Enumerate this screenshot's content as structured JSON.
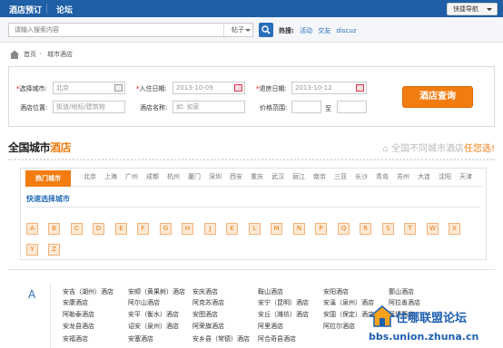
{
  "topbar": {
    "hotel_booking": "酒店预订",
    "forum": "论坛",
    "quick_nav": "快捷导航"
  },
  "search": {
    "placeholder": "请输入搜索内容",
    "scope": "帖子",
    "hot_label": "热搜:",
    "hot_tags": [
      "活动",
      "交友",
      "discuz"
    ]
  },
  "breadcrumb": {
    "home": "首页",
    "current": "城市酒店"
  },
  "form": {
    "city_label": "选择城市:",
    "city_value": "北京",
    "checkin_label": "入住日期:",
    "checkin_value": "2013-10-09",
    "checkout_label": "退房日期:",
    "checkout_value": "2013-10-12",
    "location_label": "酒店位置:",
    "location_placeholder": "街道/地标/建筑物",
    "name_label": "酒店名称:",
    "name_placeholder": "如: 如家",
    "price_label": "价格范围:",
    "price_to": "至",
    "submit": "酒店查询"
  },
  "city_section": {
    "title_prefix": "全国城市",
    "title_highlight": "酒店",
    "slogan_prefix": "全国不同城市酒店",
    "slogan_highlight": "任您选!",
    "hot_tab": "热门城市",
    "hot_cities": [
      "北京",
      "上海",
      "广州",
      "成都",
      "杭州",
      "厦门",
      "深圳",
      "西安",
      "重庆",
      "武汉",
      "丽江",
      "南京",
      "三亚",
      "长沙",
      "青岛",
      "苏州",
      "大连",
      "沈阳",
      "天津"
    ],
    "quick_pick": "快速选择城市",
    "letters": [
      "A",
      "B",
      "C",
      "D",
      "E",
      "F",
      "G",
      "H",
      "J",
      "K",
      "L",
      "M",
      "N",
      "P",
      "Q",
      "R",
      "S",
      "T",
      "W",
      "X",
      "Y",
      "Z"
    ]
  },
  "a_list": {
    "letter": "A",
    "cities": [
      [
        "安吉（湖州）酒店",
        "安顺（黄果树）酒店",
        "安庆酒店",
        "鞍山酒店",
        "安阳酒店",
        "鄞山酒店"
      ],
      [
        "安康酒店",
        "阿尔山酒店",
        "阿克苏酒店",
        "安宁（昆明）酒店",
        "安溪（泉州）酒店",
        "阿拉善酒店"
      ],
      [
        "阿勒泰酒店",
        "安平（衡水）酒店",
        "安图酒店",
        "安丘（潍坊）酒店",
        "安国（保定）酒店",
        "阿坝酒店"
      ],
      [
        "安龙县酒店",
        "诏安（泉州）酒店",
        "阿荣旗酒店",
        "阿里酒店",
        "阿拉尔酒店",
        ""
      ],
      [
        "安福酒店",
        "安塞酒店",
        "安乡县（常德）酒店",
        "阿合奇县酒店",
        "",
        ""
      ]
    ]
  },
  "watermark": {
    "title": "住哪联盟论坛",
    "url": "bbs.union.zhuna.cn"
  }
}
